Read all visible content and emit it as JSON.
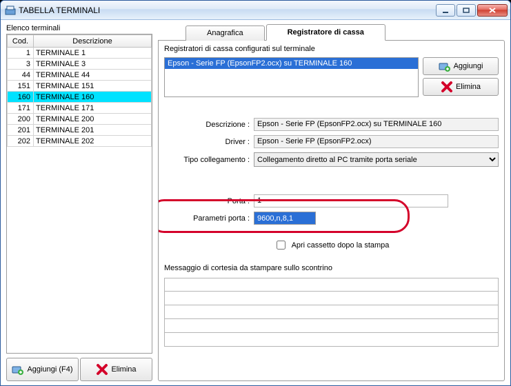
{
  "window": {
    "title": "TABELLA TERMINALI"
  },
  "left": {
    "label": "Elenco terminali",
    "cols": {
      "cod": "Cod.",
      "desc": "Descrizione"
    },
    "rows": [
      {
        "cod": "1",
        "desc": "TERMINALE 1"
      },
      {
        "cod": "3",
        "desc": "TERMINALE 3"
      },
      {
        "cod": "44",
        "desc": "TERMINALE 44"
      },
      {
        "cod": "151",
        "desc": "TERMINALE 151"
      },
      {
        "cod": "160",
        "desc": "TERMINALE 160",
        "selected": true
      },
      {
        "cod": "171",
        "desc": "TERMINALE 171"
      },
      {
        "cod": "200",
        "desc": "TERMINALE 200"
      },
      {
        "cod": "201",
        "desc": "TERMINALE 201"
      },
      {
        "cod": "202",
        "desc": "TERMINALE 202"
      }
    ],
    "add_btn": "Aggiungi (F4)",
    "del_btn": "Elimina"
  },
  "tabs": {
    "anagrafica": "Anagrafica",
    "registratore": "Registratore di cassa"
  },
  "right": {
    "list_label": "Registratori di cassa configurati sul terminale",
    "list_items": [
      {
        "text": "Epson - Serie FP (EpsonFP2.ocx) su TERMINALE 160",
        "selected": true
      }
    ],
    "add_btn": "Aggiungi",
    "del_btn": "Elimina",
    "descr_label": "Descrizione :",
    "descr_value": "Epson - Serie FP (EpsonFP2.ocx) su TERMINALE 160",
    "driver_label": "Driver :",
    "driver_value": "Epson - Serie FP (EpsonFP2.ocx)",
    "tipo_label": "Tipo collegamento :",
    "tipo_value": "Collegamento diretto al PC tramite porta seriale",
    "porta_label": "Porta :",
    "porta_value": "1",
    "param_label": "Parametri porta :",
    "param_value": "9600,n,8,1",
    "chk_label": "Apri cassetto dopo la stampa",
    "chk_checked": false,
    "msg_label": "Messaggio di cortesia da stampare sullo scontrino",
    "msg_lines": [
      "",
      "",
      "",
      "",
      ""
    ]
  }
}
